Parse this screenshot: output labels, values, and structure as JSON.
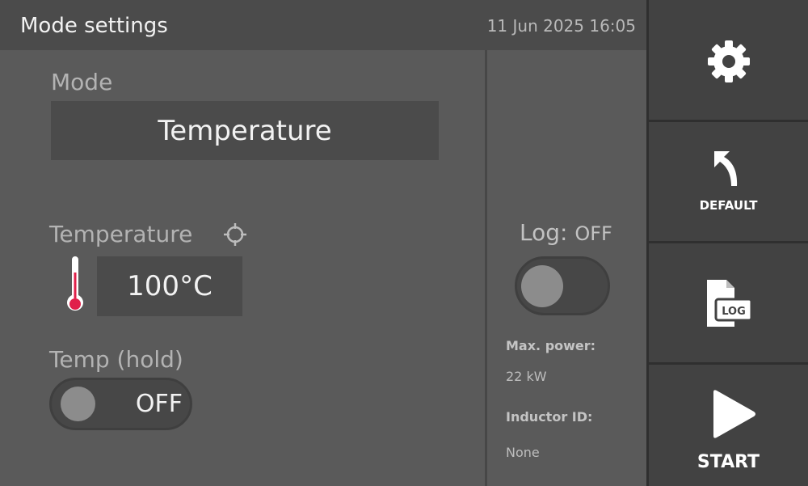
{
  "header": {
    "title": "Mode settings",
    "datetime": "11 Jun 2025 16:05"
  },
  "mode": {
    "label": "Mode",
    "value": "Temperature"
  },
  "temperature": {
    "label": "Temperature",
    "value": "100°C"
  },
  "temp_hold": {
    "label": "Temp (hold)",
    "state": "OFF"
  },
  "log": {
    "label": "Log:",
    "state": "OFF"
  },
  "info": {
    "max_power_label": "Max. power:",
    "max_power_value": "22 kW",
    "inductor_label": "Inductor ID:",
    "inductor_value": "None"
  },
  "sidebar": {
    "settings_icon": "gear-icon",
    "default_label": "DEFAULT",
    "default_icon": "undo-arrow-icon",
    "log_icon": "log-file-icon",
    "log_icon_text": "LOG",
    "start_label": "START",
    "start_icon": "play-icon"
  },
  "colors": {
    "background": "#5a5a5a",
    "header": "#4b4b4b",
    "sidebar_button": "#424242",
    "thermometer_red": "#e0204a"
  }
}
